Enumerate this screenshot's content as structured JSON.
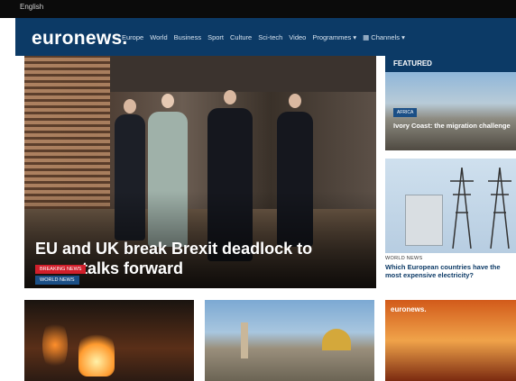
{
  "topbar": {
    "language": "English"
  },
  "header": {
    "logo": "euronews.",
    "nav": [
      "Europe",
      "World",
      "Business",
      "Sport",
      "Culture",
      "Sci-tech",
      "Video",
      "Programmes ▾",
      "▦ Channels ▾"
    ]
  },
  "hero": {
    "badge_breaking": "BREAKING NEWS",
    "badge_category": "WORLD NEWS",
    "headline": "EU and UK break Brexit deadlock to move talks forward"
  },
  "featured": {
    "label": "FEATURED",
    "card1": {
      "tag": "AFRICA",
      "title": "Ivory Coast: the migration challenge"
    },
    "card2": {
      "category": "WORLD NEWS",
      "title": "Which European countries have the most expensive electricity?"
    }
  },
  "bottom": {
    "card3_logo": "euronews."
  },
  "colors": {
    "header": "#0c3a66",
    "breaking": "#d11f2b",
    "category": "#1b4f86"
  }
}
